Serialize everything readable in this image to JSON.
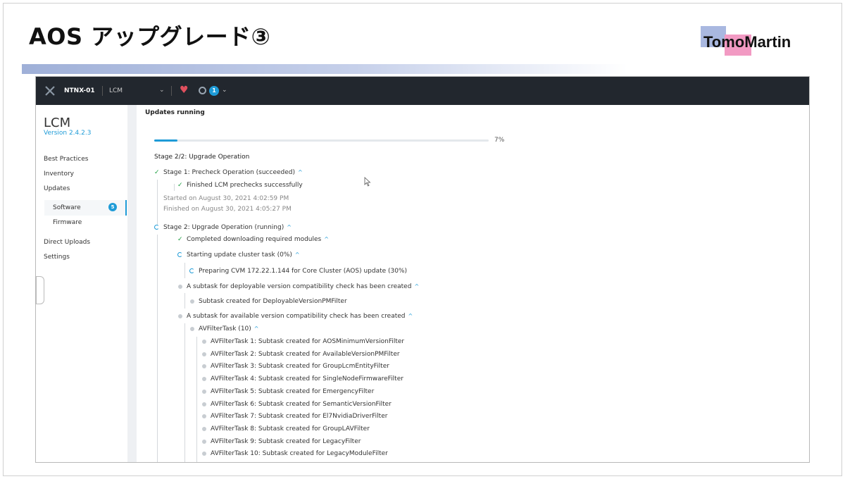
{
  "slide": {
    "title": "AOS アップグレード③",
    "logo_text": "TomoMartin"
  },
  "topnav": {
    "cluster": "NTNX-01",
    "app": "LCM",
    "alert_count": "1"
  },
  "sidebar": {
    "title": "LCM",
    "version": "Version 2.4.2.3",
    "items": [
      "Best Practices",
      "Inventory",
      "Updates"
    ],
    "sub_items": [
      "Software",
      "Firmware"
    ],
    "software_badge": "5",
    "bottom_items": [
      "Direct Uploads",
      "Settings"
    ]
  },
  "main": {
    "heading": "Updates running",
    "progress_percent": 7,
    "progress_label": "7%",
    "stage_title": "Stage 2/2: Upgrade Operation",
    "stage1": {
      "label": "Stage 1:  Precheck Operation (succeeded)",
      "task": "Finished LCM prechecks successfully",
      "started": "Started on August 30, 2021 4:02:59 PM",
      "finished": "Finished on August 30, 2021 4:05:27 PM"
    },
    "stage2": {
      "label": "Stage 2:  Upgrade Operation (running)",
      "download": "Completed downloading required modules",
      "update_task": "Starting update cluster task (0%)",
      "preparing": "Preparing CVM 172.22.1.144 for Core Cluster (AOS) update (30%)",
      "deployable": "A subtask for deployable version compatibility check has been created",
      "deployable_sub": "Subtask created for DeployableVersionPMFilter",
      "available": "A subtask for available version compatibility check has been created",
      "avfilter": "AVFilterTask (10)",
      "avfilter_tasks": [
        "AVFilterTask 1: Subtask created for AOSMinimumVersionFilter",
        "AVFilterTask 2: Subtask created for AvailableVersionPMFilter",
        "AVFilterTask 3: Subtask created for GroupLcmEntityFilter",
        "AVFilterTask 4: Subtask created for SingleNodeFirmwareFilter",
        "AVFilterTask 5: Subtask created for EmergencyFilter",
        "AVFilterTask 6: Subtask created for SemanticVersionFilter",
        "AVFilterTask 7: Subtask created for El7NvidiaDriverFilter",
        "AVFilterTask 8: Subtask created for GroupLAVFilter",
        "AVFilterTask 9: Subtask created for LegacyFilter",
        "AVFilterTask 10: Subtask created for LegacyModuleFilter"
      ]
    }
  },
  "colors": {
    "accent": "#1e9bd7",
    "success": "#1a9c3e",
    "nav_bg": "#22272e"
  }
}
